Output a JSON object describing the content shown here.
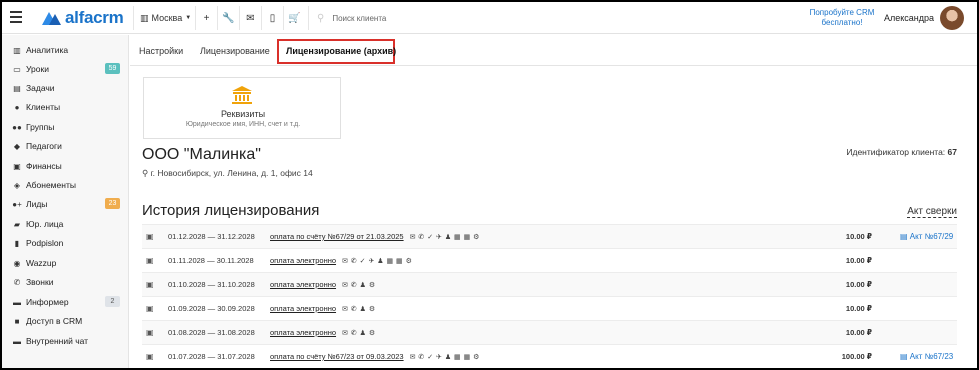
{
  "header": {
    "brand": "alfacrm",
    "city": "Москва",
    "search_placeholder": "Поиск клиента",
    "promo": "Попробуйте CRM бесплатно!",
    "user_name": "Александра",
    "brand_color": "#1a73c9"
  },
  "sidebar": {
    "items": [
      {
        "label": "Аналитика",
        "icon": "chart-icon"
      },
      {
        "label": "Уроки",
        "icon": "calendar-icon",
        "badge": "59"
      },
      {
        "label": "Задачи",
        "icon": "tasks-icon"
      },
      {
        "label": "Клиенты",
        "icon": "user-icon"
      },
      {
        "label": "Группы",
        "icon": "users-icon"
      },
      {
        "label": "Педагоги",
        "icon": "graduation-cap-icon"
      },
      {
        "label": "Финансы",
        "icon": "money-icon"
      },
      {
        "label": "Абонементы",
        "icon": "tag-icon"
      },
      {
        "label": "Лиды",
        "icon": "user-plus-icon",
        "badge": "23"
      },
      {
        "label": "Юр. лица",
        "icon": "briefcase-icon"
      },
      {
        "label": "Podpislon",
        "icon": "document-icon"
      },
      {
        "label": "Wazzup",
        "icon": "whatsapp-icon"
      },
      {
        "label": "Звонки",
        "icon": "phone-icon"
      },
      {
        "label": "Информер",
        "icon": "informer-icon",
        "badge": "2"
      },
      {
        "label": "Доступ в CRM",
        "icon": "lock-icon"
      },
      {
        "label": "Внутренний чат",
        "icon": "chat-icon"
      }
    ]
  },
  "tabs": [
    "Настройки",
    "Лицензирование",
    "Лицензирование (архив)"
  ],
  "requisites": {
    "title": "Реквизиты",
    "subtitle": "Юридическое имя, ИНН, счет и т.д."
  },
  "company": {
    "name": "ООО \"Малинка\"",
    "address": "г. Новосибирск, ул. Ленина, д. 1, офис 14",
    "client_id_label": "Идентификатор клиента:",
    "client_id": "67"
  },
  "history": {
    "title": "История лицензирования",
    "act_check": "Акт сверки",
    "rows": [
      {
        "period": "01.12.2028 — 31.12.2028",
        "payment": "оплата по счёту №67/29 от 21.03.2025",
        "options": "✉ ✆ ✓ ✈ ♟ ▦ ▦ ⚙",
        "amount": "10.00 ₽",
        "doc": "Акт №67/29"
      },
      {
        "period": "01.11.2028 — 30.11.2028",
        "payment": "оплата электронно",
        "options": "✉ ✆ ✓ ✈ ♟ ▦ ▦ ⚙",
        "amount": "10.00 ₽",
        "doc": ""
      },
      {
        "period": "01.10.2028 — 31.10.2028",
        "payment": "оплата электронно",
        "options": "✉ ✆ ♟ ⚙",
        "amount": "10.00 ₽",
        "doc": ""
      },
      {
        "period": "01.09.2028 — 30.09.2028",
        "payment": "оплата электронно",
        "options": "✉ ✆ ♟ ⚙",
        "amount": "10.00 ₽",
        "doc": ""
      },
      {
        "period": "01.08.2028 — 31.08.2028",
        "payment": "оплата электронно",
        "options": "✉ ✆ ♟ ⚙",
        "amount": "10.00 ₽",
        "doc": ""
      },
      {
        "period": "01.07.2028 — 31.07.2028",
        "payment": "оплата по счёту №67/23 от 09.03.2023",
        "options": "✉ ✆ ✓ ✈ ♟ ▦ ▦ ⚙",
        "amount": "100.00 ₽",
        "doc": "Акт №67/23"
      }
    ]
  }
}
